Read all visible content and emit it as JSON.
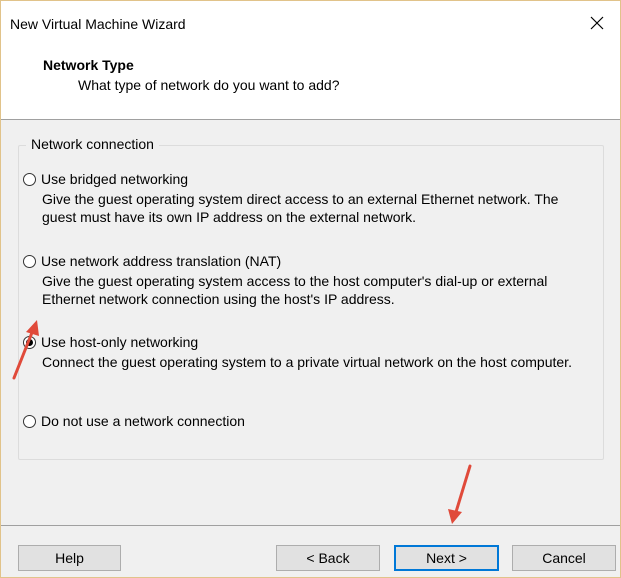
{
  "window": {
    "title": "New Virtual Machine Wizard"
  },
  "header": {
    "title": "Network Type",
    "subtitle": "What type of network do you want to add?"
  },
  "group": {
    "legend": "Network connection",
    "options": [
      {
        "label": "Use bridged networking",
        "description": "Give the guest operating system direct access to an external Ethernet network. The guest must have its own IP address on the external network.",
        "checked": false
      },
      {
        "label": "Use network address translation (NAT)",
        "description": "Give the guest operating system access to the host computer's dial-up or external Ethernet network connection using the host's IP address.",
        "checked": false
      },
      {
        "label": "Use host-only networking",
        "description": "Connect the guest operating system to a private virtual network on the host computer.",
        "checked": true
      },
      {
        "label": "Do not use a network connection",
        "description": "",
        "checked": false
      }
    ]
  },
  "buttons": {
    "help": "Help",
    "back": "< Back",
    "next": "Next >",
    "cancel": "Cancel"
  },
  "colors": {
    "annotation_arrow": "#e04a3a",
    "accent": "#0078d7"
  },
  "icons": {
    "close": "close-icon",
    "arrow": "red-annotation-arrow-icon"
  }
}
